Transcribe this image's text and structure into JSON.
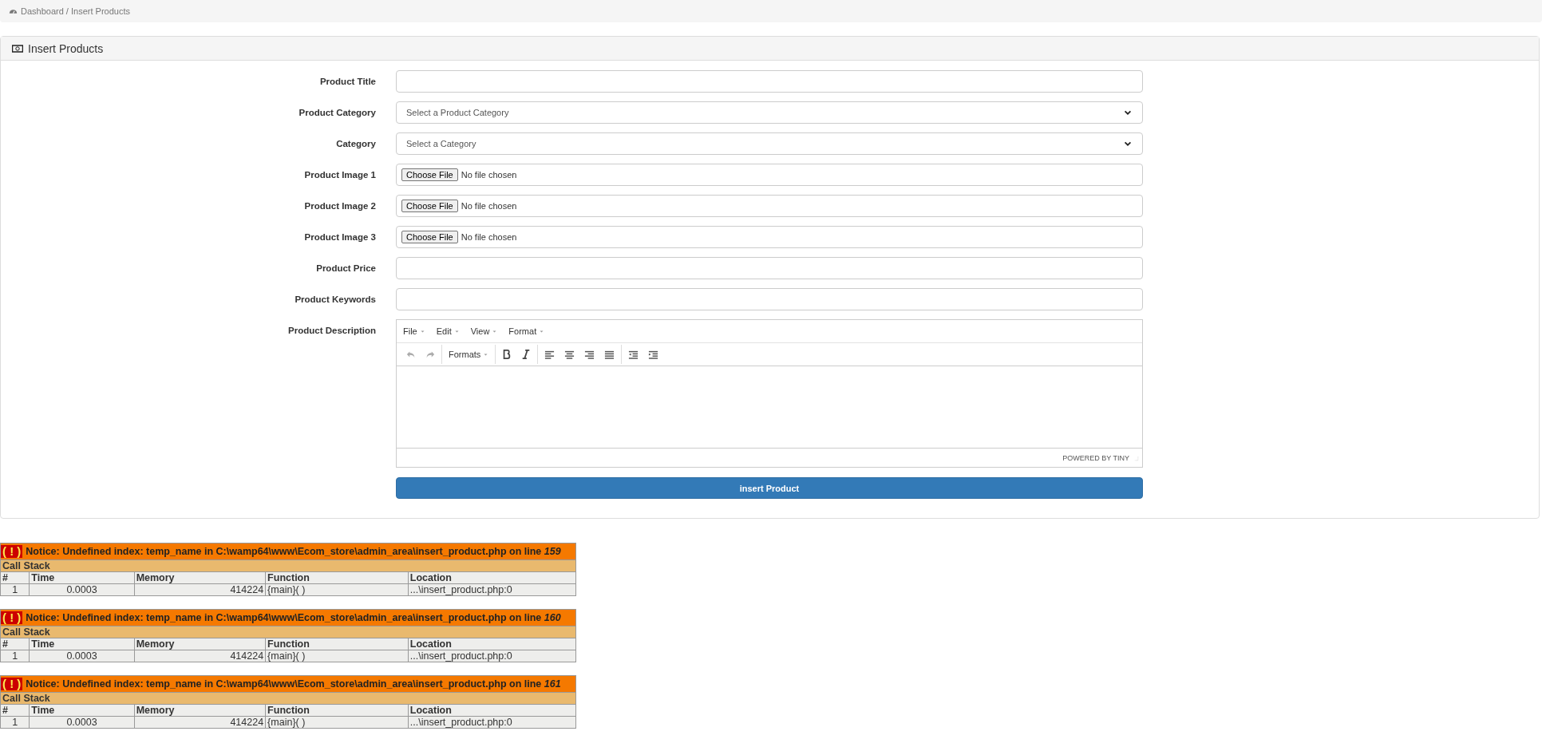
{
  "breadcrumb": "Dashboard / Insert Products",
  "panel": {
    "title": "Insert Products"
  },
  "fields": [
    {
      "kind": "text",
      "label": "Product Title"
    },
    {
      "kind": "select",
      "label": "Product Category",
      "value": "Select a Product Category"
    },
    {
      "kind": "select",
      "label": "Category",
      "value": "Select a Category"
    },
    {
      "kind": "file",
      "label": "Product Image 1",
      "button": "Choose File",
      "status": "No file chosen"
    },
    {
      "kind": "file",
      "label": "Product Image 2",
      "button": "Choose File",
      "status": "No file chosen"
    },
    {
      "kind": "file",
      "label": "Product Image 3",
      "button": "Choose File",
      "status": "No file chosen"
    },
    {
      "kind": "text",
      "label": "Product Price"
    },
    {
      "kind": "text",
      "label": "Product Keywords"
    },
    {
      "kind": "editor",
      "label": "Product Description",
      "menus": [
        "File",
        "Edit",
        "View",
        "Format"
      ],
      "formats": "Formats",
      "footer": "POWERED BY TINY"
    }
  ],
  "submit": "insert Product",
  "notices": [
    {
      "icon": "( ! )",
      "message": "Notice: Undefined index: temp_name in C:\\wamp64\\www\\Ecom_store\\admin_area\\insert_product.php on line ",
      "line": "159",
      "stack_title": "Call Stack",
      "columns": [
        "#",
        "Time",
        "Memory",
        "Function",
        "Location"
      ],
      "row": [
        "1",
        "0.0003",
        "414224",
        "{main}( )",
        "...\\insert_product.php:0"
      ]
    },
    {
      "icon": "( ! )",
      "message": "Notice: Undefined index: temp_name in C:\\wamp64\\www\\Ecom_store\\admin_area\\insert_product.php on line ",
      "line": "160",
      "stack_title": "Call Stack",
      "columns": [
        "#",
        "Time",
        "Memory",
        "Function",
        "Location"
      ],
      "row": [
        "1",
        "0.0003",
        "414224",
        "{main}( )",
        "...\\insert_product.php:0"
      ]
    },
    {
      "icon": "( ! )",
      "message": "Notice: Undefined index: temp_name in C:\\wamp64\\www\\Ecom_store\\admin_area\\insert_product.php on line ",
      "line": "161",
      "stack_title": "Call Stack",
      "columns": [
        "#",
        "Time",
        "Memory",
        "Function",
        "Location"
      ],
      "row": [
        "1",
        "0.0003",
        "414224",
        "{main}( )",
        "...\\insert_product.php:0"
      ]
    }
  ]
}
